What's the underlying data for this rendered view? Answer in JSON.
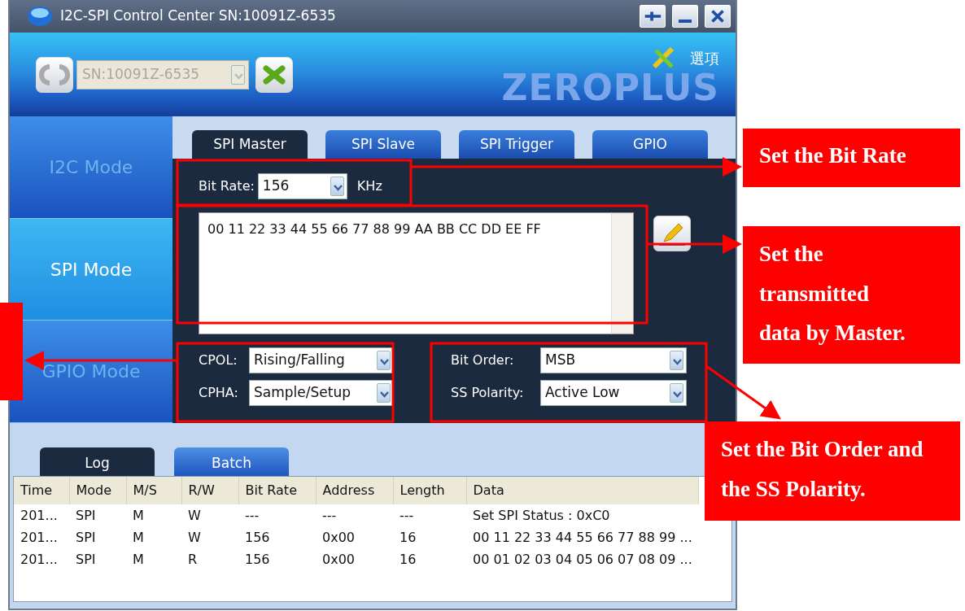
{
  "window": {
    "title": "I2C-SPI Control Center SN:10091Z-6535"
  },
  "toolbar": {
    "device": {
      "value": "SN:10091Z-6535",
      "disabled": true
    },
    "options_label": "選項",
    "brand": "ZEROPLUS"
  },
  "modes": [
    {
      "label": "I2C Mode",
      "selected": false
    },
    {
      "label": "SPI Mode",
      "selected": true
    },
    {
      "label": "GPIO Mode",
      "selected": false
    }
  ],
  "tabs": [
    {
      "label": "SPI Master",
      "selected": true
    },
    {
      "label": "SPI Slave",
      "selected": false
    },
    {
      "label": "SPI Trigger",
      "selected": false
    },
    {
      "label": "GPIO",
      "selected": false
    }
  ],
  "spi_master": {
    "bit_rate": {
      "label": "Bit Rate:",
      "value": "156",
      "unit": "KHz"
    },
    "data": "00 11 22 33 44 55 66 77 88 99 AA BB CC DD EE FF",
    "settings": [
      {
        "label": "CPOL:",
        "value": "Rising/Falling"
      },
      {
        "label": "CPHA:",
        "value": "Sample/Setup"
      },
      {
        "label": "Bit Order:",
        "value": "MSB"
      },
      {
        "label": "SS Polarity:",
        "value": "Active Low"
      }
    ]
  },
  "log_tabs": [
    {
      "label": "Log",
      "selected": true
    },
    {
      "label": "Batch",
      "selected": false
    }
  ],
  "table": {
    "columns": [
      "Time",
      "Mode",
      "M/S",
      "R/W",
      "Bit Rate",
      "Address",
      "Length",
      "Data"
    ],
    "rows": [
      [
        "201...",
        "SPI",
        "M",
        "W",
        "---",
        "---",
        "---",
        "Set SPI Status : 0xC0"
      ],
      [
        "201...",
        "SPI",
        "M",
        "W",
        "156",
        "0x00",
        "16",
        "00 11 22 33 44 55 66 77 88 99 ..."
      ],
      [
        "201...",
        "SPI",
        "M",
        "R",
        "156",
        "0x00",
        "16",
        "00 01 02 03 04 05 06 07 08 09 ..."
      ]
    ]
  },
  "annotations": [
    {
      "text": "Set the Bit Rate"
    },
    {
      "text": "Set the transmitted data by Master."
    },
    {
      "text": "Set the Bit Order and the SS Polarity."
    }
  ]
}
